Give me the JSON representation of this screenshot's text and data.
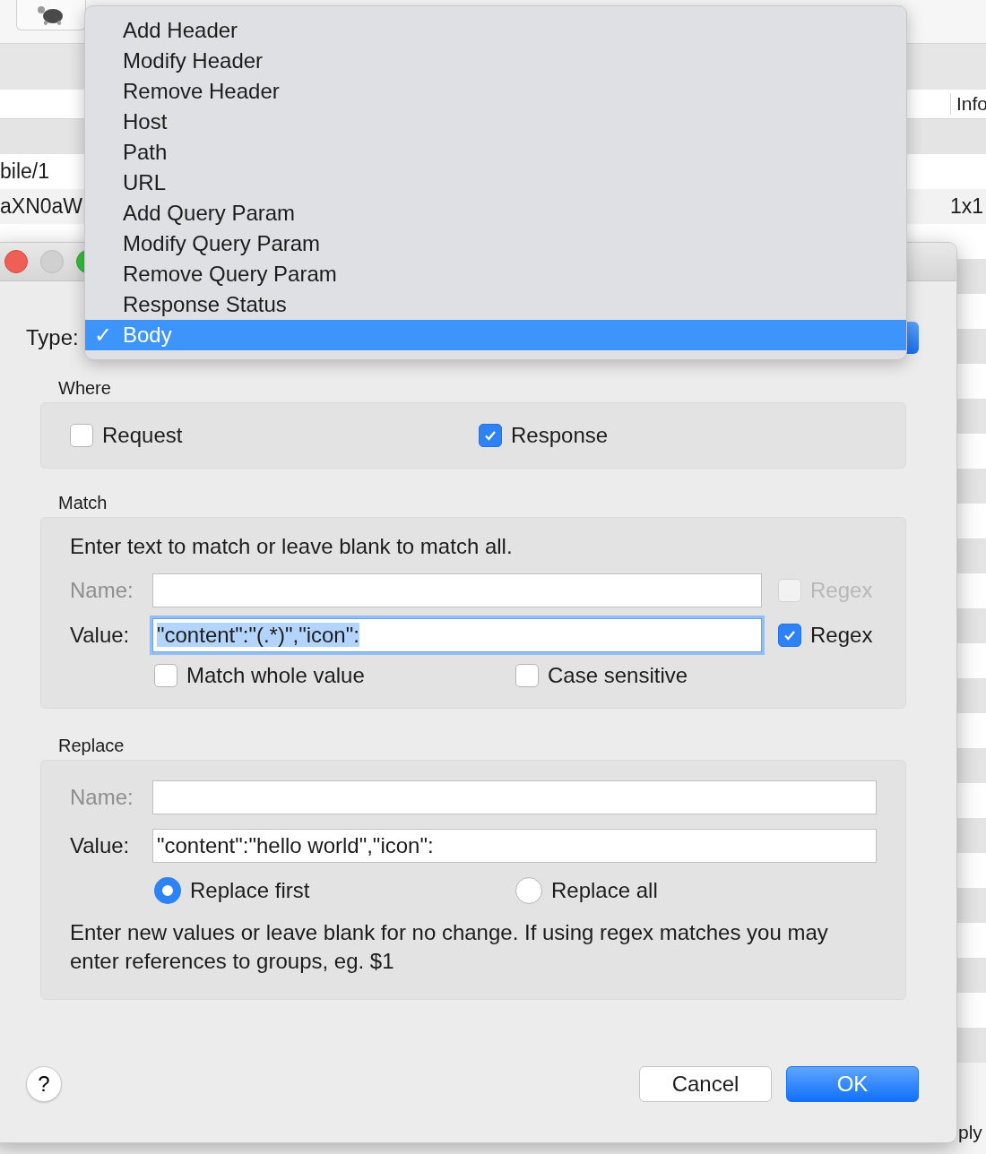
{
  "background_window": {
    "info_header": "Info",
    "left_cells": [
      "bile/1",
      "aXN0aW"
    ],
    "right_cells": [
      "1x1"
    ],
    "footer_text": "ply"
  },
  "dialog": {
    "type_label": "Type:",
    "type_menu": [
      {
        "label": "Add Header",
        "selected": false
      },
      {
        "label": "Modify Header",
        "selected": false
      },
      {
        "label": "Remove Header",
        "selected": false
      },
      {
        "label": "Host",
        "selected": false
      },
      {
        "label": "Path",
        "selected": false
      },
      {
        "label": "URL",
        "selected": false
      },
      {
        "label": "Add Query Param",
        "selected": false
      },
      {
        "label": "Modify Query Param",
        "selected": false
      },
      {
        "label": "Remove Query Param",
        "selected": false
      },
      {
        "label": "Response Status",
        "selected": false
      },
      {
        "label": "Body",
        "selected": true
      }
    ],
    "check_mark": "✓",
    "where": {
      "title": "Where",
      "options": [
        {
          "label": "Request",
          "checked": false
        },
        {
          "label": "Response",
          "checked": true
        }
      ]
    },
    "match": {
      "title": "Match",
      "hint": "Enter text to match or leave blank to match all.",
      "name": {
        "label": "Name:",
        "disabled": true,
        "regex": {
          "label": "Regex",
          "checked": false,
          "disabled": true
        }
      },
      "value": {
        "label": "Value:",
        "value": "\"content\":\"(.*)\",\"icon\":",
        "focused": true,
        "regex": {
          "label": "Regex",
          "checked": true,
          "disabled": false
        }
      },
      "options": [
        {
          "label": "Match whole value",
          "checked": false
        },
        {
          "label": "Case sensitive",
          "checked": false
        }
      ]
    },
    "replace": {
      "title": "Replace",
      "name": {
        "label": "Name:",
        "disabled": true
      },
      "value": {
        "label": "Value:",
        "value": "\"content\":\"hello world\",\"icon\":"
      },
      "modes": [
        {
          "label": "Replace first",
          "selected": true
        },
        {
          "label": "Replace all",
          "selected": false
        }
      ],
      "note": "Enter new values or leave blank for no change. If using regex matches you may enter references to groups, eg. $1"
    },
    "help_button": "?",
    "buttons": [
      {
        "label": "Cancel",
        "kind": "secondary"
      },
      {
        "label": "OK",
        "kind": "primary"
      }
    ]
  }
}
